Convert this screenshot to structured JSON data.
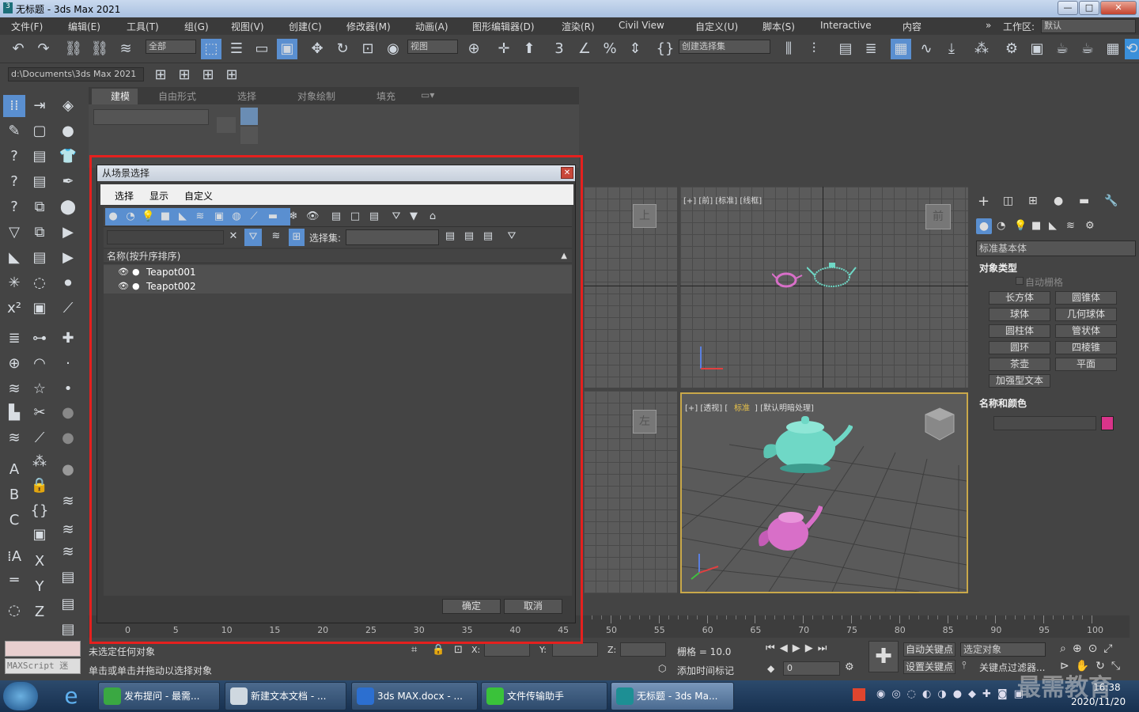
{
  "window": {
    "title": "无标题 - 3ds Max 2021"
  },
  "menu": [
    "文件(F)",
    "编辑(E)",
    "工具(T)",
    "组(G)",
    "视图(V)",
    "创建(C)",
    "修改器(M)",
    "动画(A)",
    "图形编辑器(D)",
    "渲染(R)",
    "Civil View",
    "自定义(U)",
    "脚本(S)",
    "Interactive",
    "内容"
  ],
  "workspace": {
    "label": "工作区:",
    "value": "默认"
  },
  "toolbar": {
    "filter": "全部",
    "refcoord": "视图",
    "selset": "创建选择集"
  },
  "path": "d:\\Documents\\3ds Max 2021",
  "ribbon": {
    "tabs": [
      "建模",
      "自由形式",
      "选择",
      "对象绘制",
      "填充"
    ]
  },
  "viewports": {
    "front": "[+] [前] [标准] [线框]",
    "front_cube": "前",
    "persp_a": "[+] [透视] [",
    "persp_b": "标准",
    "persp_c": "] [默认明暗处理]",
    "top_cube": "上",
    "left_cube": "左"
  },
  "dialog": {
    "title": "从场景选择",
    "menu": [
      "选择",
      "显示",
      "自定义"
    ],
    "selset_label": "选择集:",
    "list_header": "名称(按升序排序)",
    "items": [
      "Teapot001",
      "Teapot002"
    ],
    "ok": "确定",
    "cancel": "取消"
  },
  "command_panel": {
    "category": "标准基本体",
    "section1": "对象类型",
    "autogrid": "自动栅格",
    "buttons": [
      "长方体",
      "圆锥体",
      "球体",
      "几何球体",
      "圆柱体",
      "管状体",
      "圆环",
      "四棱锥",
      "茶壶",
      "平面",
      "加强型文本"
    ],
    "section2": "名称和颜色",
    "swatch": "#d9348a"
  },
  "timeline": {
    "ticks": [
      "0",
      "5",
      "10",
      "15",
      "20",
      "25",
      "30",
      "35",
      "40",
      "45",
      "50",
      "55",
      "60",
      "65",
      "70",
      "75",
      "80",
      "85",
      "90",
      "95",
      "100"
    ]
  },
  "status": {
    "msg1": "未选定任何对象",
    "msg2": "单击或单击并拖动以选择对象",
    "maxscript": "MAXScript 迷",
    "x": "X:",
    "y": "Y:",
    "z": "Z:",
    "grid": "栅格 = 10.0",
    "addtime": "添加时间标记",
    "autokey": "自动关键点",
    "selected": "选定对象",
    "setkey": "设置关键点",
    "keyfilter": "关键点过滤器...",
    "frame": "0"
  },
  "taskbar": {
    "items": [
      "发布提问 - 最需...",
      "新建文本文档 - ...",
      "3ds MAX.docx - ...",
      "文件传输助手",
      "无标题 - 3ds Ma..."
    ],
    "time": "16:38",
    "date": "2020/11/20",
    "watermark": "最需教育"
  },
  "colors": {
    "highlight": "#e5201e",
    "teapot_cyan": "#6fd8c6",
    "teapot_pink": "#d86fc8",
    "accent": "#5a8fd0"
  }
}
